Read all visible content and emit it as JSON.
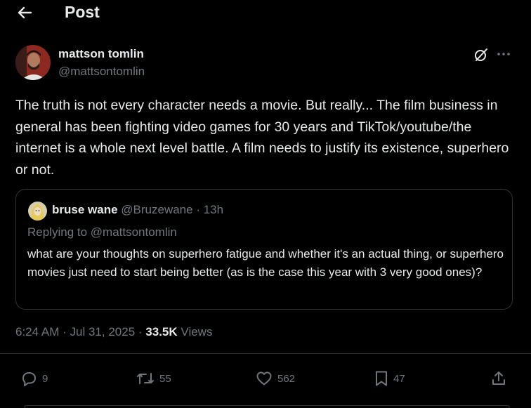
{
  "header": {
    "title": "Post",
    "back_icon": "arrow-left-icon"
  },
  "post": {
    "author_name": "mattson tomlin",
    "author_handle": "@mattsontomlin",
    "text": "The truth is not every character needs a movie. But really... The film business in general has been fighting video games for 30 years and TikTok/youtube/the internet is a whole next level battle. A film needs to justify its existence, superhero or not.",
    "icons": [
      "grok-icon",
      "more-icon"
    ]
  },
  "quote": {
    "name": "bruse wane",
    "handle": "@Bruzewane",
    "time": "· 13h",
    "replying": "Replying to @mattsontomlin",
    "text": "what are your thoughts on superhero fatigue and whether it's an actual thing, or superhero movies just need to start being better (as is the case this year with 3 very good ones)?"
  },
  "meta": {
    "time": "6:24 AM",
    "sep1": "·",
    "date": "Jul 31, 2025",
    "sep2": "·",
    "views_count": "33.5K",
    "views_label": "Views"
  },
  "actions": {
    "reply": "9",
    "repost": "55",
    "like": "562",
    "bookmark": "47"
  },
  "colors": {
    "background": "#000000",
    "text": "#e7e9ea",
    "muted": "#71767b",
    "border": "#2f3336"
  }
}
